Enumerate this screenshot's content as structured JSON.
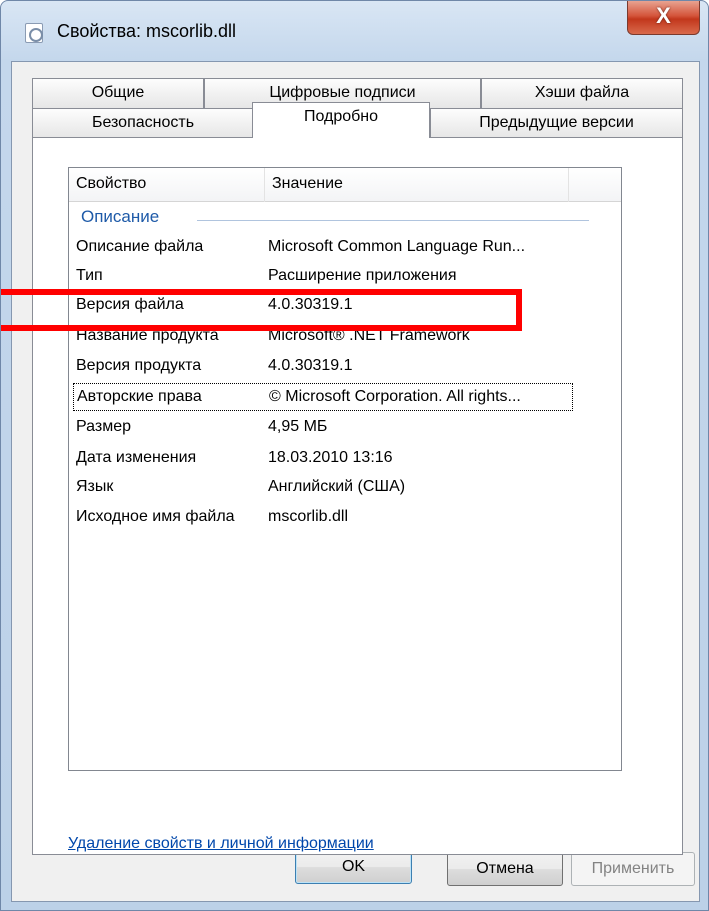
{
  "window": {
    "title": "Свойства: mscorlib.dll",
    "close_glyph": "X"
  },
  "tabs_row1": [
    {
      "label": "Общие"
    },
    {
      "label": "Цифровые подписи"
    },
    {
      "label": "Хэши файла"
    }
  ],
  "tabs_row2": [
    {
      "label": "Безопасность"
    },
    {
      "label": "Подробно",
      "active": true
    },
    {
      "label": "Предыдущие версии"
    }
  ],
  "list": {
    "columns": [
      "Свойство",
      "Значение"
    ],
    "group": "Описание",
    "rows": [
      {
        "prop": "Описание файла",
        "val": "Microsoft Common Language Run..."
      },
      {
        "prop": "Тип",
        "val": "Расширение приложения"
      },
      {
        "prop": "Версия файла",
        "val": "4.0.30319.1"
      },
      {
        "prop": "Название продукта",
        "val": "Microsoft® .NET Framework"
      },
      {
        "prop": "Версия продукта",
        "val": "4.0.30319.1"
      },
      {
        "prop": "Авторские права",
        "val": "© Microsoft Corporation.  All rights..."
      },
      {
        "prop": "Размер",
        "val": "4,95 МБ"
      },
      {
        "prop": "Дата изменения",
        "val": "18.03.2010 13:16"
      },
      {
        "prop": "Язык",
        "val": "Английский (США)"
      },
      {
        "prop": "Исходное имя файла",
        "val": "mscorlib.dll"
      }
    ]
  },
  "link": "Удаление свойств и личной информации",
  "buttons": {
    "ok": "OK",
    "cancel": "Отмена",
    "apply": "Применить"
  },
  "colors": {
    "highlight": "#ff0000",
    "link": "#0047ab",
    "group_label": "#1e5aa8"
  }
}
